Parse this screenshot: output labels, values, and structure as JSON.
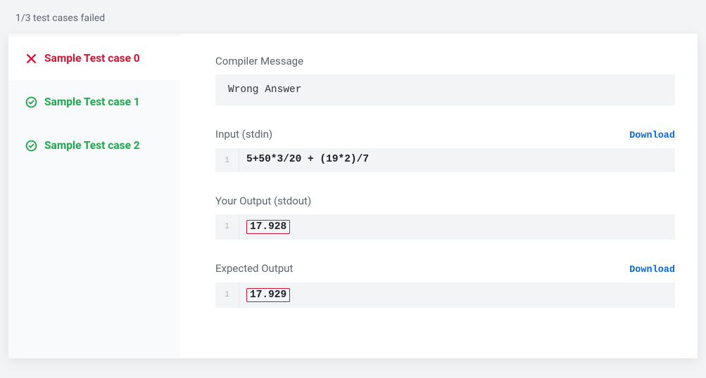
{
  "summary": "1/3 test cases failed",
  "sidebar": {
    "items": [
      {
        "label": "Sample Test case 0",
        "status": "fail"
      },
      {
        "label": "Sample Test case 1",
        "status": "pass"
      },
      {
        "label": "Sample Test case 2",
        "status": "pass"
      }
    ]
  },
  "compiler": {
    "title": "Compiler Message",
    "message": "Wrong Answer"
  },
  "input": {
    "title": "Input (stdin)",
    "download": "Download",
    "line_no": "1",
    "content": "5+50*3/20 + (19*2)/7"
  },
  "your_output": {
    "title": "Your Output (stdout)",
    "line_no": "1",
    "content": "17.928"
  },
  "expected_output": {
    "title": "Expected Output",
    "download": "Download",
    "line_no": "1",
    "content": "17.929"
  }
}
